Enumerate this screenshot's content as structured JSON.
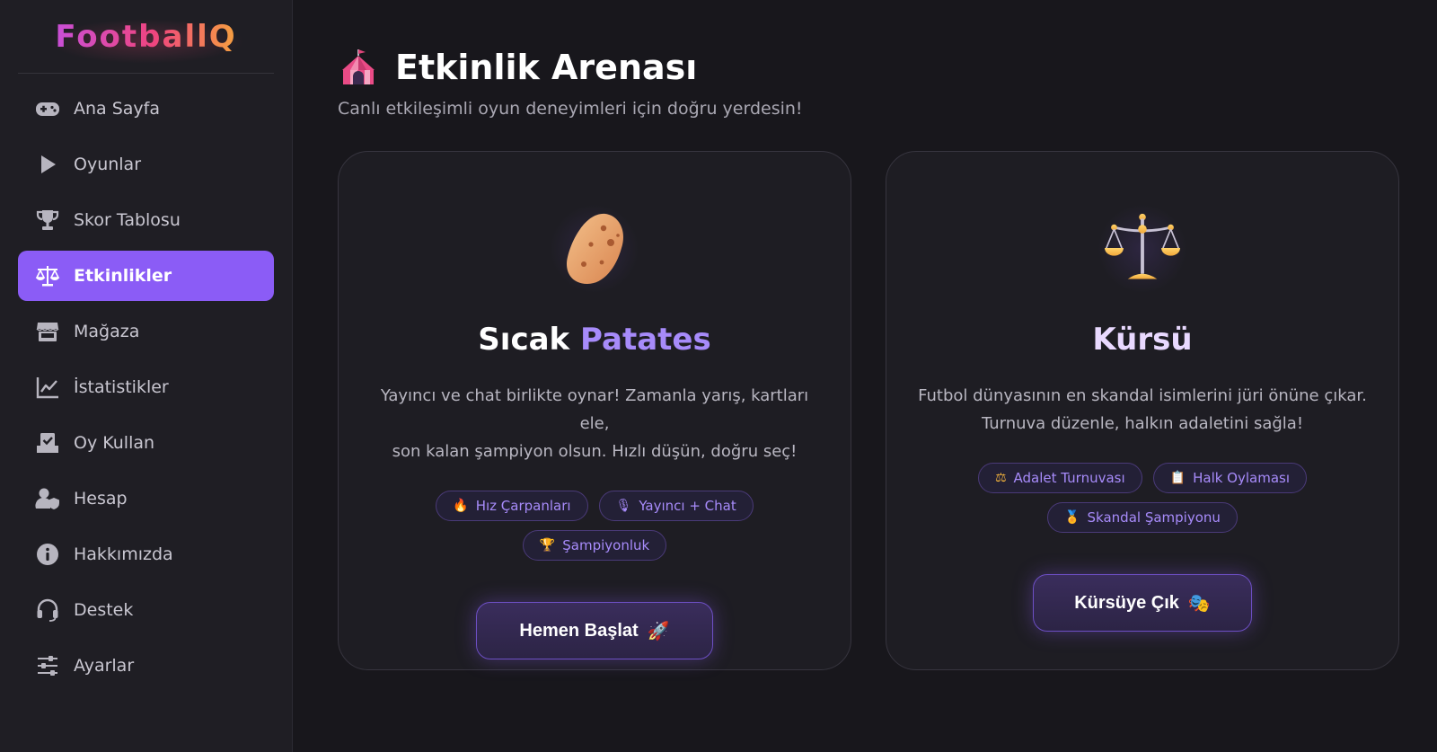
{
  "app": {
    "logo": "FootballQ"
  },
  "sidebar": {
    "items": [
      {
        "label": "Ana Sayfa",
        "icon": "gamepad-icon"
      },
      {
        "label": "Oyunlar",
        "icon": "play-icon"
      },
      {
        "label": "Skor Tablosu",
        "icon": "trophy-icon"
      },
      {
        "label": "Etkinlikler",
        "icon": "scale-icon",
        "active": true
      },
      {
        "label": "Mağaza",
        "icon": "store-icon"
      },
      {
        "label": "İstatistikler",
        "icon": "chart-line-icon"
      },
      {
        "label": "Oy Kullan",
        "icon": "vote-box-icon"
      },
      {
        "label": "Hesap",
        "icon": "user-shield-icon"
      },
      {
        "label": "Hakkımızda",
        "icon": "info-icon"
      },
      {
        "label": "Destek",
        "icon": "headset-icon"
      },
      {
        "label": "Ayarlar",
        "icon": "sliders-icon"
      }
    ]
  },
  "main": {
    "title": "Etkinlik Arenası",
    "title_icon": "circus-tent-icon",
    "subtitle": "Canlı etkileşimli oyun deneyimleri için doğru yerdesin!",
    "cards": [
      {
        "icon": "potato-icon",
        "title_part1": "Sıcak",
        "title_part2": "Patates",
        "description_line1": "Yayıncı ve chat birlikte oynar! Zamanla yarış, kartları ele,",
        "description_line2": "son kalan şampiyon olsun. Hızlı düşün, doğru seç!",
        "tags": [
          {
            "icon": "🔥",
            "label": "Hız Çarpanları"
          },
          {
            "icon": "🎙",
            "label": "Yayıncı + Chat"
          },
          {
            "icon": "🏆",
            "label": "Şampiyonluk"
          }
        ],
        "button_label": "Hemen Başlat",
        "button_icon": "🚀"
      },
      {
        "icon": "balance-scale-icon",
        "title": "Kürsü",
        "description_line1": "Futbol dünyasının en skandal isimlerini jüri önüne çıkar.",
        "description_line2": "Turnuva düzenle, halkın adaletini sağla!",
        "tags": [
          {
            "icon": "⚖",
            "label": "Adalet Turnuvası"
          },
          {
            "icon": "📋",
            "label": "Halk Oylaması"
          },
          {
            "icon": "🏅",
            "label": "Skandal Şampiyonu"
          }
        ],
        "button_label": "Kürsüye Çık",
        "button_icon": "🎭"
      }
    ]
  },
  "colors": {
    "accent": "#8b5cf6",
    "accent_light": "#a78bfa",
    "background": "#18171c",
    "sidebar": "#1f1e24"
  }
}
